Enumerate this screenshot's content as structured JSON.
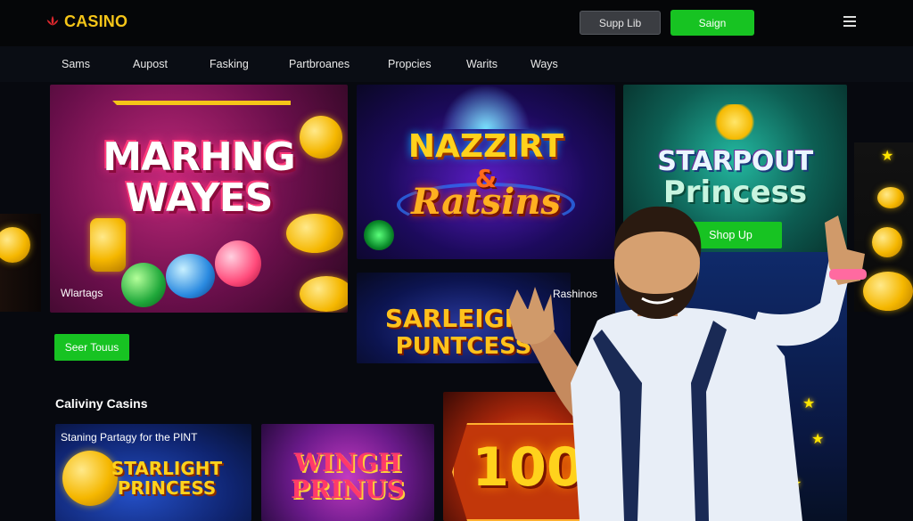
{
  "header": {
    "logo_text": "CASINO",
    "support_label": "Supp Lib",
    "signin_label": "Saign"
  },
  "nav": {
    "items": [
      "Sams",
      "Aupost",
      "Fasking",
      "Partbroanes",
      "Propcies",
      "Warits",
      "Ways"
    ]
  },
  "featured": {
    "card1": {
      "title_line1": "MARHNG",
      "title_line2": "WAYES",
      "label": "Wlartags"
    },
    "card2": {
      "title_line1": "NAZZIRT",
      "title_line2": "&",
      "title_line3": "Ratsins"
    },
    "card3": {
      "title_line1": "STARPOUT",
      "title_line2": "Princess",
      "button_label": "Shop Up"
    },
    "card4": {
      "title_line1": "SARLEIGHT",
      "title_line2": "PUNTCESS",
      "label": "Rashinos"
    }
  },
  "see_more_label": "Seer Touus",
  "section": {
    "title": "Caliviny Casins",
    "cards": [
      {
        "label": "Staning Partagy for the PINT",
        "title_line1": "STARLIGHT",
        "title_line2": "PRINCESS"
      },
      {
        "title_line1": "WINGH",
        "title_line2": "PRINUS"
      },
      {
        "title_line1": "100"
      }
    ]
  },
  "colors": {
    "accent_green": "#17c322",
    "logo_gold": "#f5c518",
    "background": "#07090f"
  },
  "icons": [
    "logo-lotus-icon",
    "hamburger-menu-icon"
  ]
}
